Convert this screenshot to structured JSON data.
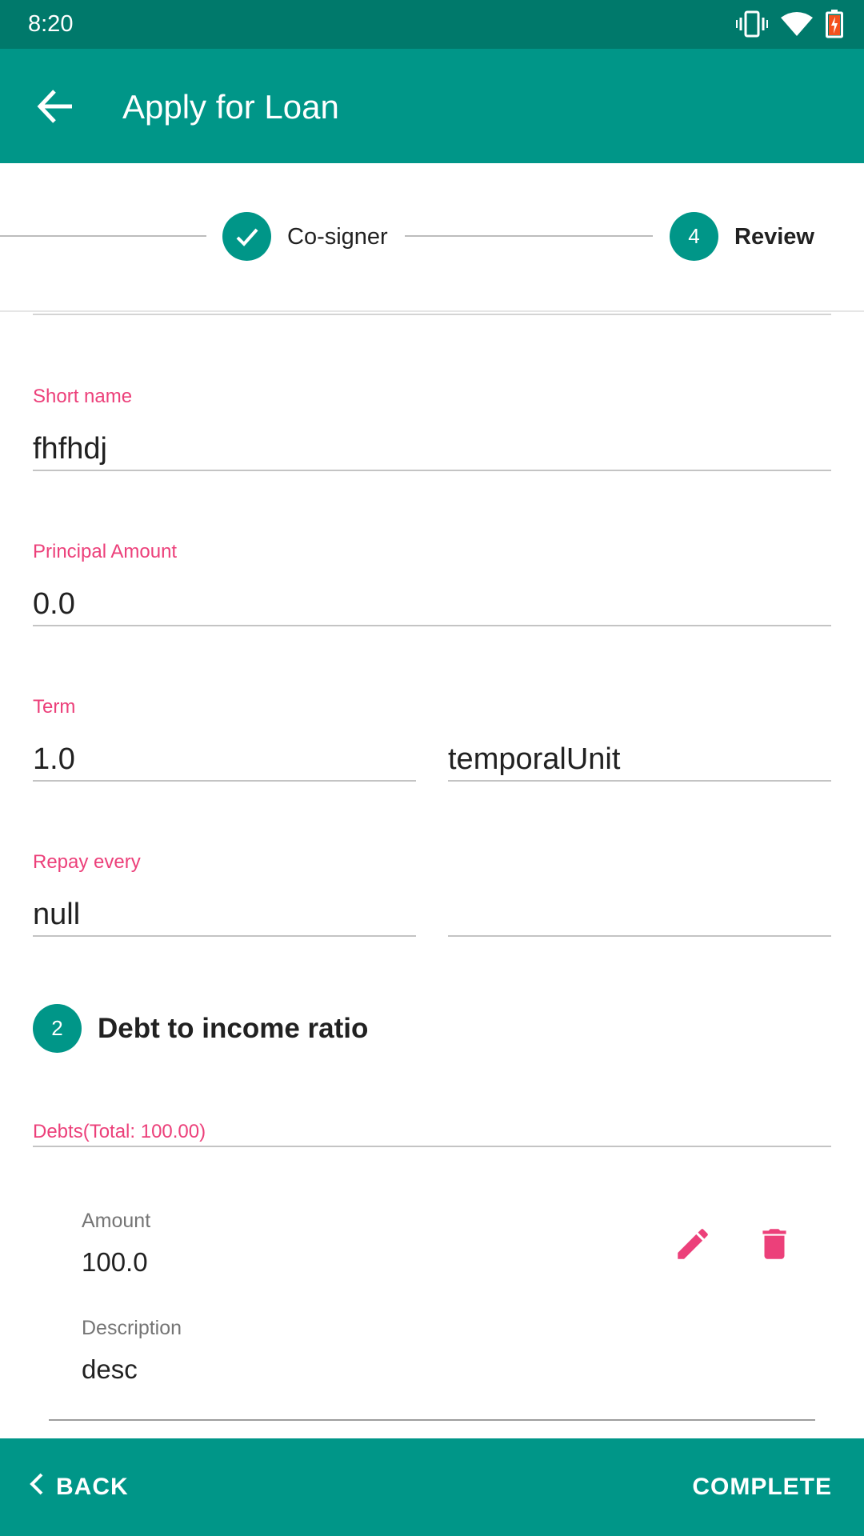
{
  "status_bar": {
    "time": "8:20",
    "icons": [
      "vibrate-icon",
      "wifi-icon",
      "battery-charging-icon"
    ]
  },
  "app_bar": {
    "title": "Apply for Loan",
    "back_icon": "arrow-left-icon"
  },
  "stepper": {
    "steps": [
      {
        "label": "Co-signer",
        "state": "completed"
      },
      {
        "label": "Review",
        "number": "4",
        "state": "active"
      }
    ]
  },
  "form": {
    "short_name": {
      "label": "Short name",
      "value": "fhfhdj"
    },
    "principal_amount": {
      "label": "Principal Amount",
      "value": "0.0"
    },
    "term": {
      "label": "Term",
      "value": "1.0",
      "unit": "temporalUnit"
    },
    "repay_every": {
      "label": "Repay every",
      "value": "null",
      "unit": ""
    }
  },
  "debt_section": {
    "number": "2",
    "title": "Debt to income ratio",
    "debts_label": "Debts(Total: 100.00)",
    "items": [
      {
        "amount_label": "Amount",
        "amount": "100.0",
        "description_label": "Description",
        "description": "desc"
      }
    ]
  },
  "bottom_bar": {
    "back_label": "BACK",
    "complete_label": "COMPLETE"
  },
  "colors": {
    "primary": "#009688",
    "primary_dark": "#00796b",
    "accent": "#ec407a"
  }
}
